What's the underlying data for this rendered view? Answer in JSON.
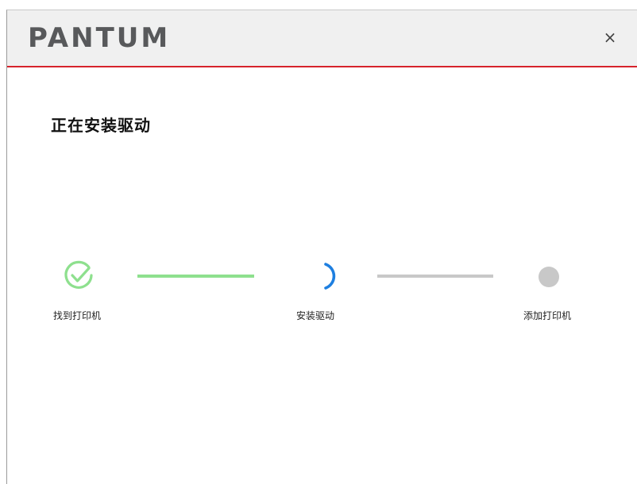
{
  "window": {
    "brand": "PANTUM",
    "close_glyph": "×"
  },
  "page": {
    "title": "正在安装驱动"
  },
  "steps": [
    {
      "label": "找到打印机",
      "state": "done",
      "icon": "check-circle-icon"
    },
    {
      "label": "安装驱动",
      "state": "in-progress",
      "icon": "spinner-icon"
    },
    {
      "label": "添加打印机",
      "state": "pending",
      "icon": "dot-icon"
    }
  ],
  "colors": {
    "accent_red": "#d6232b",
    "done_green": "#8ee08e",
    "progress_blue": "#1e7fe0",
    "pending_gray": "#c8c8c8"
  }
}
